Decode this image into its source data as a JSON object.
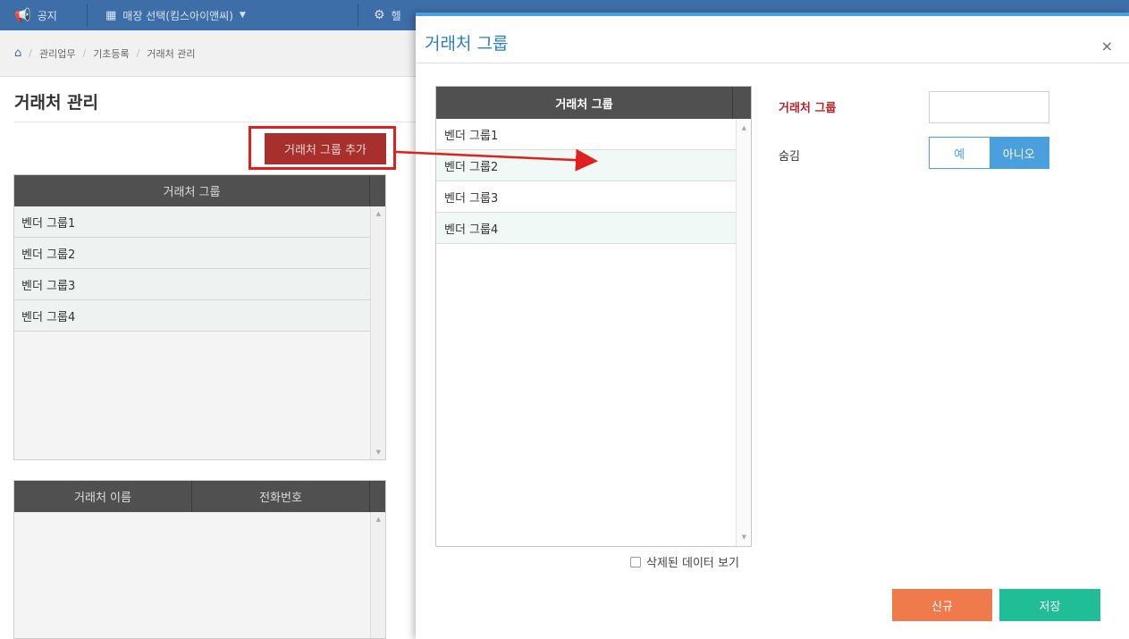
{
  "topbar": {
    "notice": "공지",
    "store_select": "매장 선택(킴스아이앤씨)",
    "help": "헬"
  },
  "breadcrumb": [
    "관리업무",
    "기초등록",
    "거래처 관리"
  ],
  "page": {
    "title": "거래처 관리",
    "add_group_button": "거래처 그룹 추가",
    "group_grid": {
      "header": "거래처 그룹",
      "rows": [
        "벤더 그룹1",
        "벤더 그룹2",
        "벤더 그룹3",
        "벤더 그룹4"
      ]
    },
    "vendor_grid": {
      "headers": [
        "거래처 이름",
        "전화번호"
      ]
    }
  },
  "modal": {
    "title": "거래처 그룹",
    "close": "×",
    "grid": {
      "header": "거래처 그룹",
      "rows": [
        "벤더 그룹1",
        "벤더 그룹2",
        "벤더 그룹3",
        "벤더 그룹4"
      ]
    },
    "show_deleted": "삭제된 데이터 보기",
    "form": {
      "group_label": "거래처 그룹",
      "group_value": "",
      "hide_label": "숨김",
      "yes": "예",
      "no": "아니오",
      "hide_selected": "아니오"
    },
    "new_button": "신규",
    "save_button": "저장"
  },
  "colors": {
    "topbar": "#3e6ea8",
    "accent": "#4aa0dc",
    "danger": "#a8302c",
    "annotation": "#e0201e",
    "new": "#ef7a4b",
    "save": "#1fbe96"
  }
}
